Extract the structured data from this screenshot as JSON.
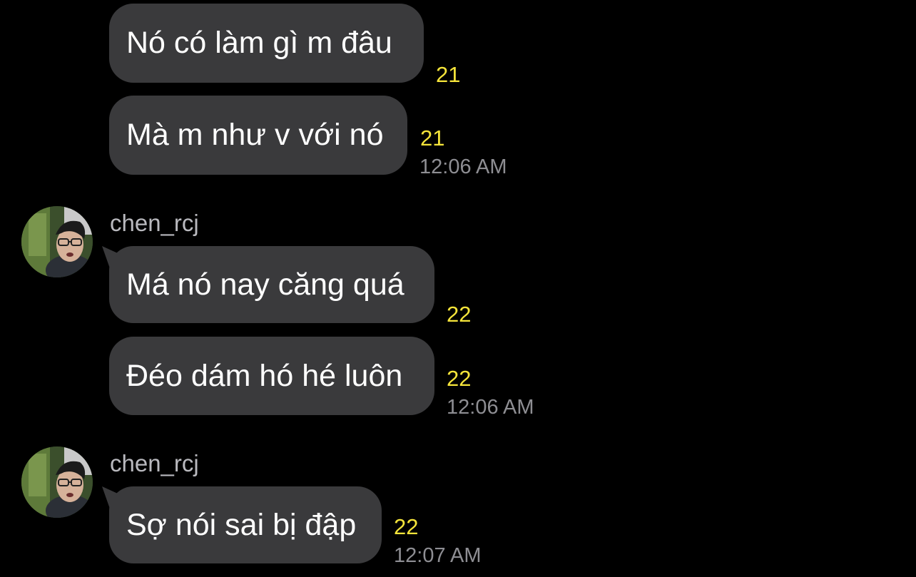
{
  "messages": [
    {
      "text": "Nó có làm gì m đâu",
      "read_count": "21"
    },
    {
      "text": "Mà m như v với nó",
      "read_count": "21",
      "time": "12:06 AM"
    },
    {
      "sender": "chen_rcj",
      "text": "Má nó nay căng quá",
      "read_count": "22"
    },
    {
      "text": "Đéo dám hó hé luôn",
      "read_count": "22",
      "time": "12:06 AM"
    },
    {
      "sender": "chen_rcj",
      "text": "Sợ nói sai bị đập",
      "read_count": "22",
      "time": "12:07 AM"
    }
  ],
  "colors": {
    "background": "#000000",
    "bubble": "#3a3a3c",
    "read_count": "#f5e43a",
    "timestamp": "#8e8e93"
  }
}
